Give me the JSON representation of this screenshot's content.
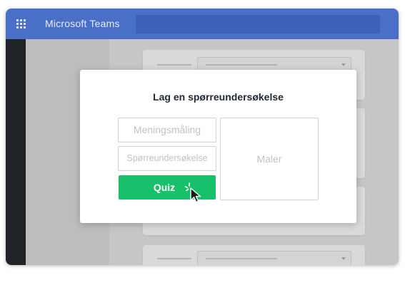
{
  "titlebar": {
    "app_title": "Microsoft Teams",
    "apps_icon": "app-grid-icon"
  },
  "modal": {
    "title": "Lag en spørreundersøkelse",
    "options": {
      "poll_label": "Meningsmåling",
      "survey_label": "Spørreundersøkelse",
      "templates_label": "Maler",
      "quiz_label": "Quiz"
    },
    "cursor_icon": "mouse-pointer-icon",
    "click_icon": "click-sparkle-icon"
  },
  "colors": {
    "titlebar": "#4a6fc7",
    "rail": "#1f2227",
    "quiz_button": "#18c06b",
    "modal_title": "#222a35"
  }
}
